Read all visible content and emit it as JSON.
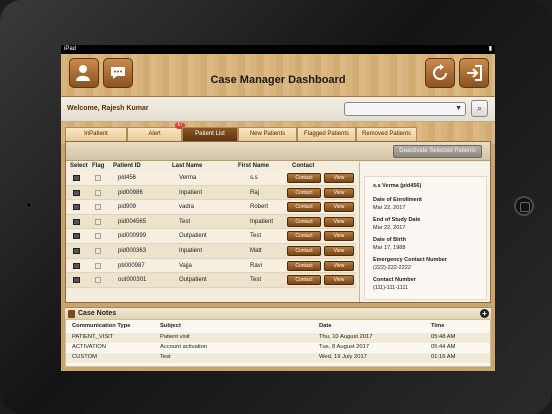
{
  "status_bar": {
    "carrier": "iPad",
    "time": ""
  },
  "header": {
    "title": "Case Manager Dashboard"
  },
  "welcome": {
    "text": "Welcome, Rajesh Kumar"
  },
  "search": {
    "selected": ""
  },
  "tabs": [
    {
      "label": "InPatient"
    },
    {
      "label": "Alert",
      "badge": "67"
    },
    {
      "label": "Patient List"
    },
    {
      "label": "New Patients"
    },
    {
      "label": "Flagged Patients"
    },
    {
      "label": "Removed Patients"
    }
  ],
  "toolbar": {
    "deactivate_label": "Deactivate Selected Patients"
  },
  "table": {
    "columns": [
      "Select",
      "Flag",
      "Patient ID",
      "Last  Name",
      "First Name",
      "Contact"
    ],
    "contact_label": "Contact",
    "view_label": "View",
    "rows": [
      {
        "id": "pid456",
        "last": "Verma",
        "first": "s.s"
      },
      {
        "id": "pid00986",
        "last": "Inpatient",
        "first": "Raj"
      },
      {
        "id": "pid909",
        "last": "vadra",
        "first": "Robert"
      },
      {
        "id": "pid004565",
        "last": "Test",
        "first": "Inpatient"
      },
      {
        "id": "pid000999",
        "last": "Outpatient",
        "first": "Test"
      },
      {
        "id": "pid000363",
        "last": "Inpatient",
        "first": "Matt"
      },
      {
        "id": "pb000987",
        "last": "Vajja",
        "first": "Ravi"
      },
      {
        "id": "out000301",
        "last": "Outpatient",
        "first": "Test"
      }
    ]
  },
  "details": {
    "name": "s.s Verma (pid456)",
    "enrollment_label": "Date of Enrollment",
    "enrollment_value": "Mar 22, 2017",
    "end_label": "End of Study Date",
    "end_value": "Mar 22, 2017",
    "dob_label": "Date of Birth",
    "dob_value": "Mar 17, 1988",
    "emergency_label": "Emergency Contact Number",
    "emergency_value": "(222)-222-2222",
    "contact_label": "Contact Number",
    "contact_value": "(111)-111-1111"
  },
  "case_notes": {
    "title": "Case Notes",
    "columns": [
      "Communication Type",
      "Subject",
      "Date",
      "Time"
    ],
    "rows": [
      {
        "type": "PATIENT_VISIT",
        "subject": "Patient visit",
        "date": "Thu, 10 August 2017",
        "time": "05:48 AM"
      },
      {
        "type": "ACTIVATION",
        "subject": "Account activation",
        "date": "Tue, 8 August 2017",
        "time": "05:44 AM"
      },
      {
        "type": "CUSTOM",
        "subject": "Test",
        "date": "Wed, 19 July 2017",
        "time": "01:16 AM"
      }
    ]
  }
}
